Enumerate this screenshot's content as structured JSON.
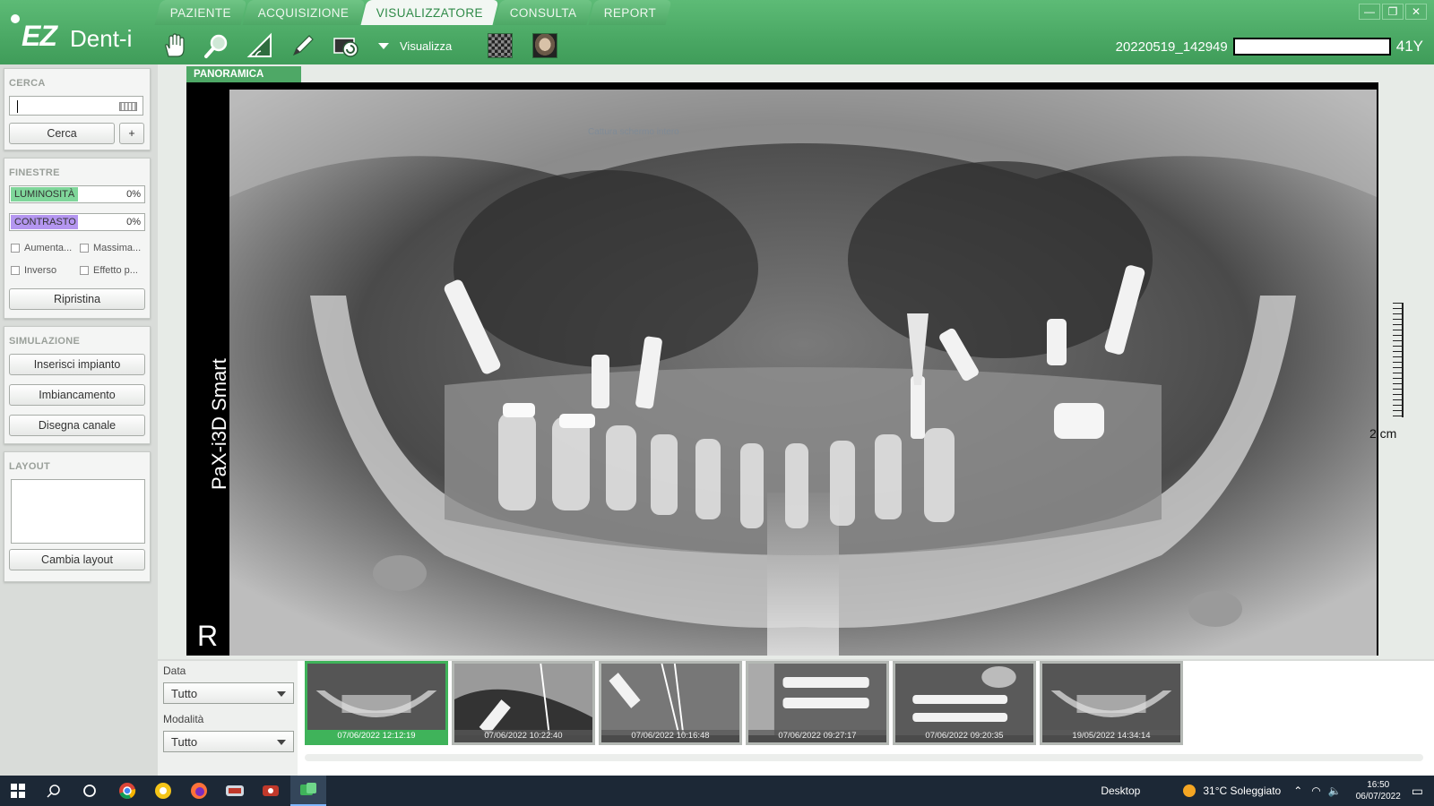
{
  "app": {
    "logo_main": "EZ",
    "logo_sub": "Dent-i"
  },
  "tabs": [
    {
      "label": "PAZIENTE"
    },
    {
      "label": "ACQUISIZIONE"
    },
    {
      "label": "VISUALIZZATORE"
    },
    {
      "label": "CONSULTA"
    },
    {
      "label": "REPORT"
    }
  ],
  "active_tab": "VISUALIZZATORE",
  "toolbar": {
    "tools": [
      "hand-icon",
      "zoom-icon",
      "measure-angle-icon",
      "pen-icon",
      "capture-icon"
    ],
    "view_label": "Visualizza"
  },
  "patient": {
    "study_id": "20220519_142949",
    "age": "41Y"
  },
  "window_controls": [
    "—",
    "❐",
    "✕"
  ],
  "search": {
    "title": "CERCA",
    "value": "",
    "search_button": "Cerca",
    "add_button": "+"
  },
  "windows": {
    "title": "FINESTRE",
    "brightness": {
      "label": "LUMINOSITÀ",
      "value": "0%"
    },
    "contrast": {
      "label": "CONTRASTO",
      "value": "0%"
    },
    "options": [
      "Aumenta...",
      "Massima...",
      "Inverso",
      "Effetto p..."
    ],
    "reset_button": "Ripristina"
  },
  "simulation": {
    "title": "SIMULAZIONE",
    "buttons": [
      "Inserisci impianto",
      "Imbiancamento",
      "Disegna canale"
    ]
  },
  "layout": {
    "title": "LAYOUT",
    "change_button": "Cambia layout"
  },
  "viewer": {
    "label": "PANORAMICA",
    "device": "PaX-i3D Smart",
    "side_marker": "R",
    "scale": "2 cm",
    "overlay_text": "Cattura schermo intero"
  },
  "filters": {
    "date_label": "Data",
    "date_value": "Tutto",
    "modality_label": "Modalità",
    "modality_value": "Tutto"
  },
  "thumbnails": [
    {
      "datetime": "07/06/2022 12:12:19",
      "kind": "pano",
      "selected": true
    },
    {
      "datetime": "07/06/2022 10:22:40",
      "kind": "implant-diag",
      "selected": false
    },
    {
      "datetime": "07/06/2022 10:16:48",
      "kind": "endo",
      "selected": false
    },
    {
      "datetime": "07/06/2022 09:27:17",
      "kind": "implants-horiz",
      "selected": false
    },
    {
      "datetime": "07/06/2022 09:20:35",
      "kind": "implants-horiz-2",
      "selected": false
    },
    {
      "datetime": "19/05/2022 14:34:14",
      "kind": "pano",
      "selected": false
    }
  ],
  "taskbar": {
    "apps": [
      "windows-icon",
      "search-icon",
      "cortana-icon",
      "chrome-icon",
      "norton-icon",
      "firefox-icon",
      "ez-app-icon",
      "recorder-icon",
      "ezdent-icon"
    ],
    "desktop_label": "Desktop",
    "weather": "31°C  Soleggiato",
    "time": "16:50",
    "date": "06/07/2022"
  }
}
